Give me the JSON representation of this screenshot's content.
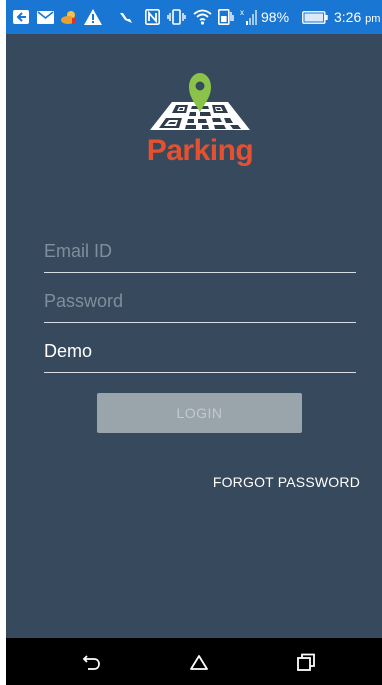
{
  "status_bar": {
    "battery_percent": "98%",
    "time": "3:26",
    "time_suffix": "pm",
    "background": "#1976d2",
    "icons": [
      "hangouts-icon",
      "mail-icon",
      "weather-icon",
      "warning-icon",
      "missed-call-icon",
      "nfc-icon",
      "vibrate-icon",
      "wifi-icon",
      "data-icon",
      "signal-icon",
      "battery-icon"
    ]
  },
  "logo": {
    "text": "Parking",
    "pin_color": "#8bc34a",
    "text_color": "#e5512f"
  },
  "form": {
    "email": {
      "placeholder": "Email ID",
      "value": ""
    },
    "password": {
      "placeholder": "Password",
      "value": ""
    },
    "demo": {
      "value": "Demo"
    },
    "login_label": "LOGIN",
    "forgot_password_label": "FORGOT PASSWORD"
  },
  "theme": {
    "background": "#374a5d",
    "button_disabled": "#9aa4ab"
  },
  "nav_bar": {
    "icons": [
      "back-icon",
      "home-icon",
      "recents-icon"
    ]
  }
}
